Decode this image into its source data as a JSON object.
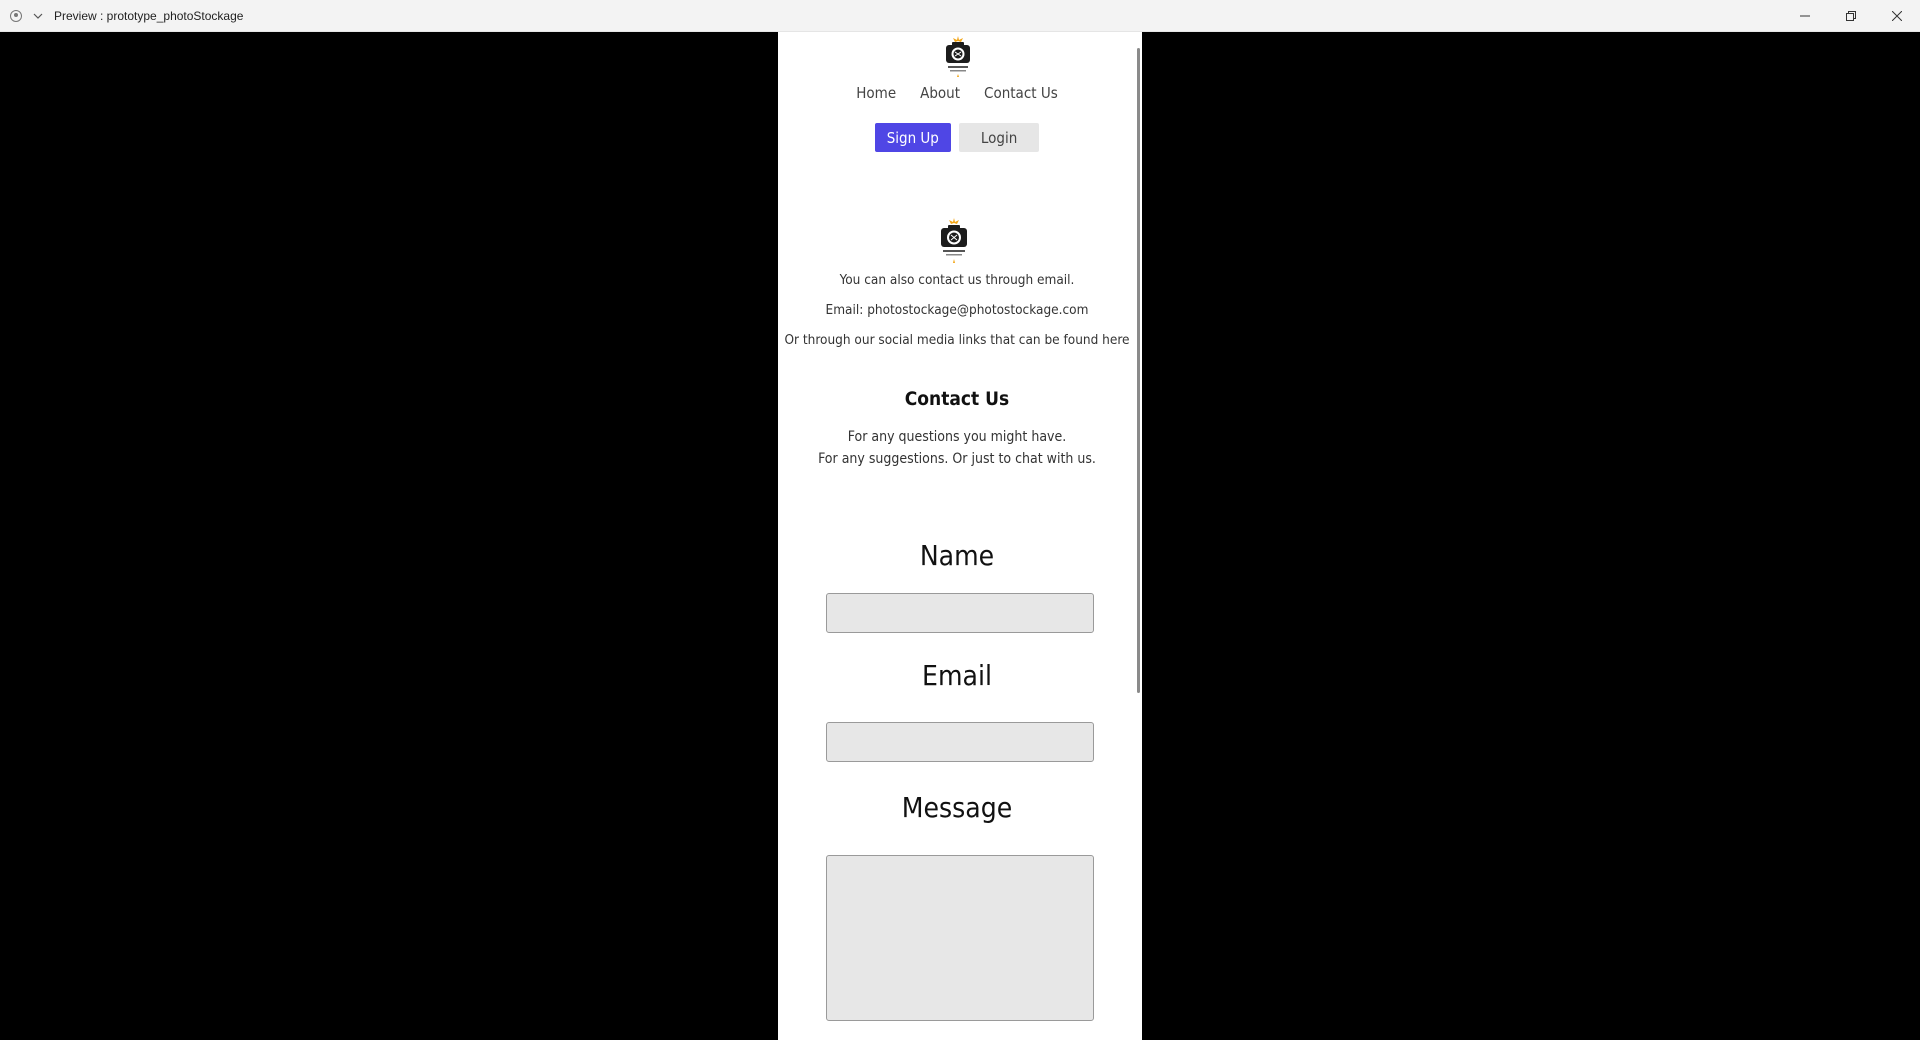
{
  "window": {
    "title": "Preview : prototype_photoStockage",
    "icons": [
      "app-icon",
      "chevron-down-icon",
      "minimize-icon",
      "restore-icon",
      "close-icon"
    ]
  },
  "nav": {
    "home": "Home",
    "about": "About",
    "contact": "Contact Us"
  },
  "auth": {
    "signup": "Sign Up",
    "login": "Login",
    "signup_color": "#4f46e5"
  },
  "contact_info": {
    "line1": "You can also contact us through email.",
    "line2": "Email: photostockage@photostockage.com",
    "line3": "Or through our social media links that can be found here"
  },
  "section": {
    "title": "Contact Us",
    "line1": "For any questions you might have.",
    "line2": "For any suggestions. Or just to chat with us."
  },
  "form": {
    "name_label": "Name",
    "email_label": "Email",
    "message_label": "Message"
  }
}
